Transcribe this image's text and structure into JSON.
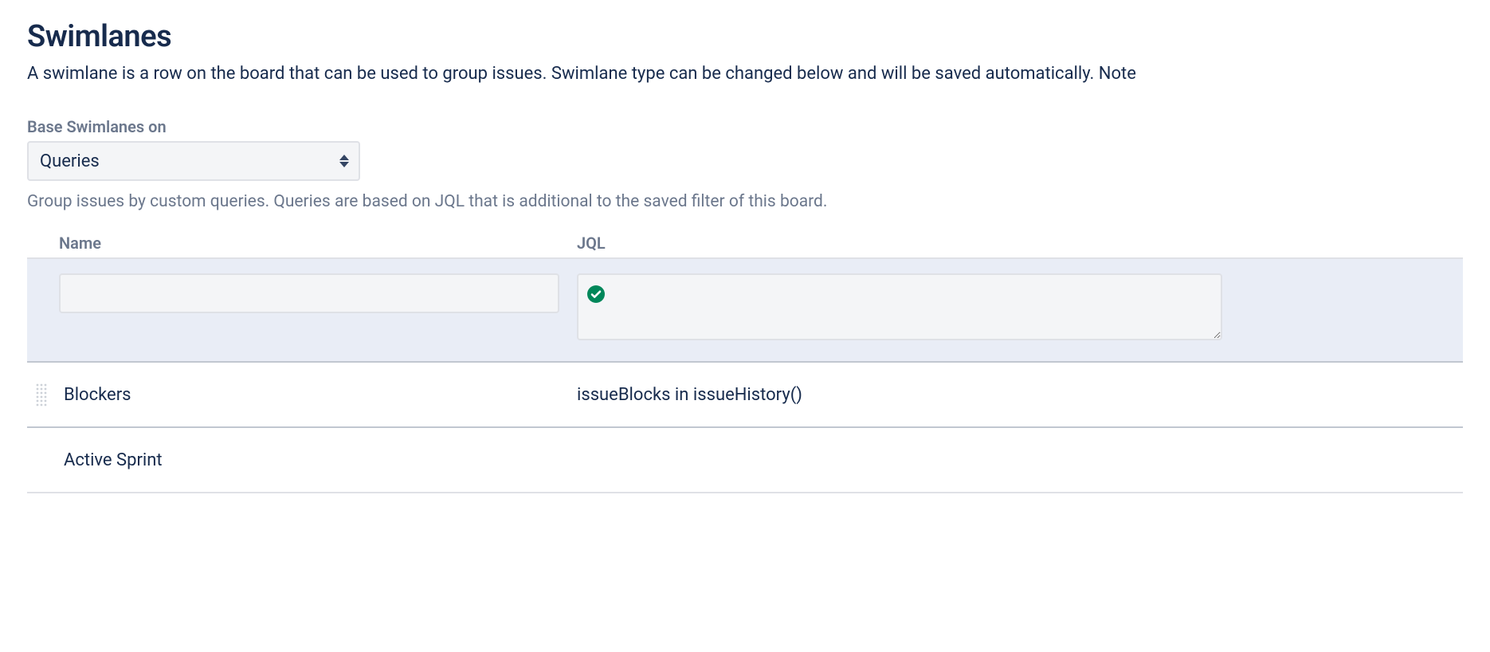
{
  "title": "Swimlanes",
  "description": "A swimlane is a row on the board that can be used to group issues. Swimlane type can be changed below and will be saved automatically. Note",
  "base_swimlanes": {
    "label": "Base Swimlanes on",
    "selected": "Queries",
    "help": "Group issues by custom queries. Queries are based on JQL that is additional to the saved filter of this board."
  },
  "columns": {
    "name": "Name",
    "jql": "JQL"
  },
  "new_row": {
    "name_value": "",
    "jql_value": "",
    "jql_valid_icon": "check-circle"
  },
  "rows": [
    {
      "name": "Blockers",
      "jql": "issueBlocks in issueHistory()",
      "has_handle": true
    },
    {
      "name": "Active Sprint",
      "jql": "",
      "has_handle": false
    }
  ]
}
